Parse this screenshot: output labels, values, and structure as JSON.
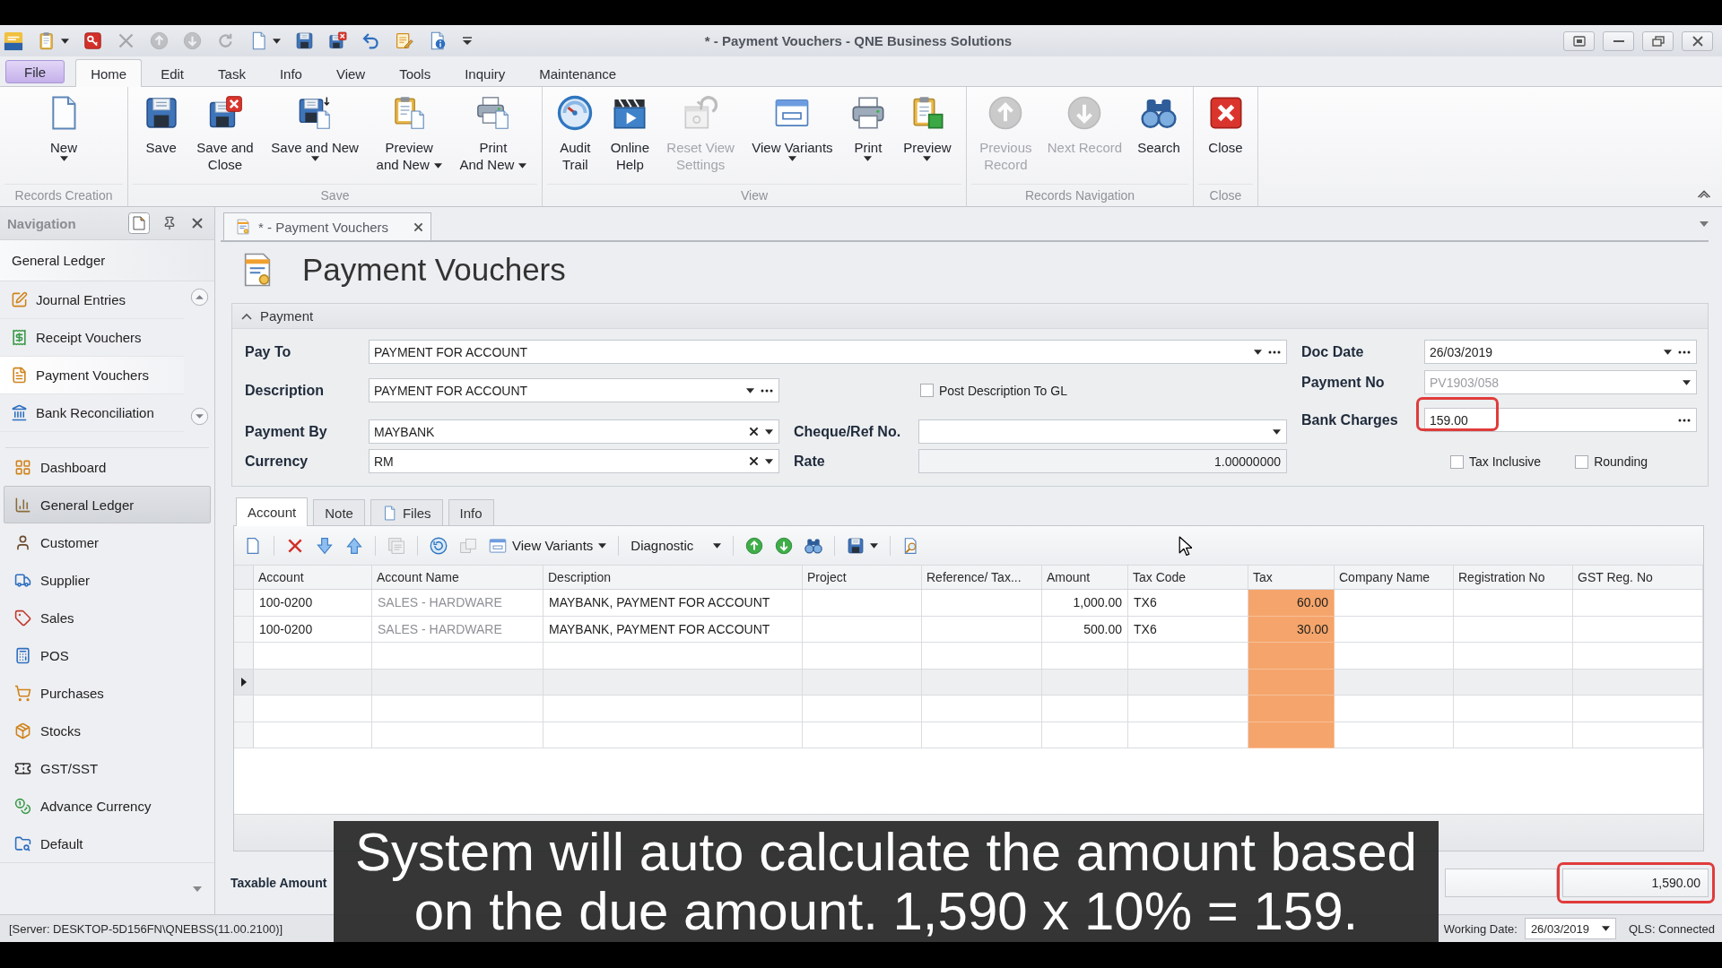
{
  "window": {
    "title": "* - Payment Vouchers - QNE Business Solutions"
  },
  "quick_access": [
    {
      "disabled": false,
      "dropdown": true
    },
    {
      "disabled": false,
      "dropdown": false
    },
    {
      "disabled": true,
      "dropdown": false
    },
    {
      "disabled": true,
      "dropdown": false
    },
    {
      "disabled": true,
      "dropdown": false
    },
    {
      "disabled": true,
      "dropdown": false
    },
    {
      "disabled": false,
      "dropdown": true
    },
    {
      "disabled": false,
      "dropdown": false
    },
    {
      "disabled": false,
      "dropdown": false
    },
    {
      "disabled": false,
      "dropdown": false
    },
    {
      "disabled": false,
      "dropdown": false
    },
    {
      "disabled": false,
      "dropdown": false
    }
  ],
  "menu_tabs": [
    {
      "label": "File",
      "kind": "backstage",
      "selected": false
    },
    {
      "label": "Home",
      "kind": "tab",
      "selected": true
    },
    {
      "label": "Edit",
      "kind": "tab",
      "selected": false
    },
    {
      "label": "Task",
      "kind": "tab",
      "selected": false
    },
    {
      "label": "Info",
      "kind": "tab",
      "selected": false
    },
    {
      "label": "View",
      "kind": "tab",
      "selected": false
    },
    {
      "label": "Tools",
      "kind": "tab",
      "selected": false
    },
    {
      "label": "Inquiry",
      "kind": "tab",
      "selected": false
    },
    {
      "label": "Maintenance",
      "kind": "tab",
      "selected": false
    }
  ],
  "ribbon": [
    {
      "label": "Records Creation",
      "buttons": [
        {
          "label": "New",
          "dropdown": true,
          "disabled": false
        }
      ]
    },
    {
      "label": "Save",
      "buttons": [
        {
          "label": "Save",
          "dropdown": false,
          "disabled": false
        },
        {
          "label": "Save and\nClose",
          "dropdown": false,
          "disabled": false
        },
        {
          "label": "Save and New",
          "dropdown": true,
          "disabled": false
        },
        {
          "label": "Preview\nand New",
          "dropdown": true,
          "disabled": false
        },
        {
          "label": "Print\nAnd New",
          "dropdown": true,
          "disabled": false
        }
      ]
    },
    {
      "label": "View",
      "buttons": [
        {
          "label": "Audit\nTrail",
          "dropdown": false,
          "disabled": false
        },
        {
          "label": "Online\nHelp",
          "dropdown": false,
          "disabled": false
        },
        {
          "label": "Reset View\nSettings",
          "dropdown": false,
          "disabled": true
        },
        {
          "label": "View Variants",
          "dropdown": true,
          "disabled": false
        },
        {
          "label": "Print",
          "dropdown": true,
          "disabled": false
        },
        {
          "label": "Preview",
          "dropdown": true,
          "disabled": false
        }
      ]
    },
    {
      "label": "Records Navigation",
      "buttons": [
        {
          "label": "Previous\nRecord",
          "dropdown": false,
          "disabled": true
        },
        {
          "label": "Next Record",
          "dropdown": false,
          "disabled": true
        },
        {
          "label": "Search",
          "dropdown": false,
          "disabled": false
        }
      ]
    },
    {
      "label": "Close",
      "buttons": [
        {
          "label": "Close",
          "dropdown": false,
          "disabled": false
        }
      ]
    }
  ],
  "navigation": {
    "title": "Navigation",
    "section": "General Ledger",
    "items": [
      {
        "label": "Journal Entries",
        "selected": false
      },
      {
        "label": "Receipt Vouchers",
        "selected": false
      },
      {
        "label": "Payment Vouchers",
        "selected": true
      },
      {
        "label": "Bank Reconciliation",
        "selected": false
      }
    ],
    "modules": [
      {
        "label": "Dashboard",
        "selected": false
      },
      {
        "label": "General Ledger",
        "selected": true
      },
      {
        "label": "Customer",
        "selected": false
      },
      {
        "label": "Supplier",
        "selected": false
      },
      {
        "label": "Sales",
        "selected": false
      },
      {
        "label": "POS",
        "selected": false
      },
      {
        "label": "Purchases",
        "selected": false
      },
      {
        "label": "Stocks",
        "selected": false
      },
      {
        "label": "GST/SST",
        "selected": false
      },
      {
        "label": "Advance Currency",
        "selected": false
      },
      {
        "label": "Default",
        "selected": false
      }
    ]
  },
  "document_tabs": [
    {
      "label": "* - Payment Vouchers",
      "selected": true
    }
  ],
  "form": {
    "title": "Payment Vouchers",
    "section": {
      "title": "Payment",
      "expanded": true
    },
    "pay_to": {
      "label": "Pay To",
      "value": "PAYMENT FOR ACCOUNT"
    },
    "description": {
      "label": "Description",
      "value": "PAYMENT FOR ACCOUNT"
    },
    "post_description_to_gl": {
      "label": "Post Description To GL",
      "checked": false
    },
    "payment_by": {
      "label": "Payment By",
      "value": "MAYBANK"
    },
    "currency": {
      "label": "Currency",
      "value": "RM"
    },
    "cheque_ref_no": {
      "label": "Cheque/Ref No."
    },
    "rate": {
      "label": "Rate",
      "value": "1.00000000"
    },
    "doc_date": {
      "label": "Doc Date",
      "value": "26/03/2019"
    },
    "payment_no": {
      "label": "Payment No",
      "value": "PV1903/058",
      "disabled": true
    },
    "bank_charges": {
      "label": "Bank Charges",
      "value": "159.00",
      "highlighted": true
    },
    "tax_inclusive": {
      "label": "Tax Inclusive",
      "checked": false
    },
    "rounding": {
      "label": "Rounding",
      "checked": false
    }
  },
  "detail_tabs": [
    {
      "label": "Account",
      "selected": true,
      "kind": "plain"
    },
    {
      "label": "Note",
      "selected": false,
      "kind": "plain"
    },
    {
      "label": "Files",
      "selected": false,
      "kind": "icon"
    },
    {
      "label": "Info",
      "selected": false,
      "kind": "plain"
    }
  ],
  "grid_toolbar": [
    {
      "disabled": false,
      "dropdown": false
    },
    {
      "disabled": false,
      "dropdown": false
    },
    {
      "disabled": false,
      "dropdown": false
    },
    {
      "disabled": false,
      "dropdown": false
    },
    {
      "disabled": true,
      "dropdown": false
    },
    {
      "disabled": false,
      "dropdown": false
    },
    {
      "disabled": true,
      "dropdown": false
    },
    {
      "label": "View Variants",
      "disabled": false,
      "dropdown": true
    },
    {
      "label": "Diagnostic",
      "disabled": false,
      "dropdown": true
    },
    {
      "disabled": false,
      "dropdown": false
    },
    {
      "disabled": false,
      "dropdown": false
    },
    {
      "disabled": false,
      "dropdown": false
    },
    {
      "disabled": false,
      "dropdown": true
    },
    {
      "disabled": false,
      "dropdown": false
    }
  ],
  "grid": {
    "columns": [
      {
        "label": "Account",
        "kind": "text",
        "read_only": false,
        "highlighted": false
      },
      {
        "label": "Account Name",
        "kind": "text",
        "read_only": true,
        "highlighted": false
      },
      {
        "label": "Description",
        "kind": "text",
        "read_only": false,
        "highlighted": false
      },
      {
        "label": "Project",
        "kind": "text",
        "read_only": false,
        "highlighted": false
      },
      {
        "label": "Reference/ Tax...",
        "kind": "text",
        "read_only": false,
        "highlighted": false
      },
      {
        "label": "Amount",
        "kind": "number",
        "read_only": false,
        "highlighted": false
      },
      {
        "label": "Tax Code",
        "kind": "text",
        "read_only": false,
        "highlighted": false
      },
      {
        "label": "Tax",
        "kind": "number",
        "read_only": false,
        "highlighted": true
      },
      {
        "label": "Company Name",
        "kind": "text",
        "read_only": false,
        "highlighted": false
      },
      {
        "label": "Registration No",
        "kind": "text",
        "read_only": false,
        "highlighted": false
      },
      {
        "label": "GST Reg. No",
        "kind": "text",
        "read_only": false,
        "highlighted": false
      }
    ],
    "rows": [
      {
        "focused": false,
        "account": "100-0200",
        "account_name": "SALES - HARDWARE",
        "description": "MAYBANK, PAYMENT FOR ACCOUNT",
        "amount": "1,000.00",
        "tax_code": "TX6",
        "tax": "60.00"
      },
      {
        "focused": false,
        "account": "100-0200",
        "account_name": "SALES - HARDWARE",
        "description": "MAYBANK, PAYMENT FOR ACCOUNT",
        "amount": "500.00",
        "tax_code": "TX6",
        "tax": "30.00"
      },
      {
        "focused": false
      },
      {
        "focused": true
      },
      {
        "focused": false
      },
      {
        "focused": false
      }
    ]
  },
  "summary": {
    "taxable_amount_label": "Taxable Amount",
    "due_amount": {
      "value": "1,590.00",
      "highlighted": true
    }
  },
  "status_bar": {
    "server": "[Server: DESKTOP-5D156FN\\QNEBSS(11.00.2100)]",
    "working_date_label": "Working Date:",
    "working_date": "26/03/2019",
    "connection": "QLS: Connected"
  },
  "subtitle": "System will auto calculate the amount based\non the due amount. 1,590 x 10% = 159."
}
